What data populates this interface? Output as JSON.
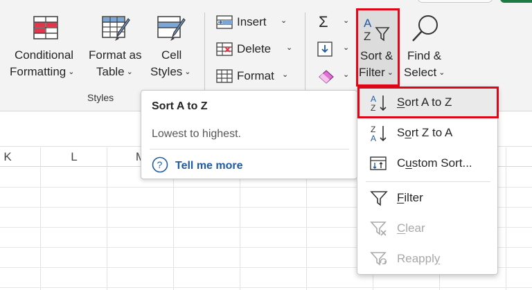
{
  "ribbon": {
    "styles_group": {
      "conditional_formatting": {
        "line1": "Conditional",
        "line2": "Formatting"
      },
      "format_as_table": {
        "line1": "Format as",
        "line2": "Table"
      },
      "cell_styles": {
        "line1": "Cell",
        "line2": "Styles"
      },
      "group_label": "Styles"
    },
    "cells_group": {
      "insert": "Insert",
      "delete": "Delete",
      "format": "Format"
    },
    "editing_group": {
      "sort_filter": {
        "line1": "Sort &",
        "line2": "Filter"
      },
      "find_select": {
        "line1": "Find &",
        "line2": "Select"
      }
    }
  },
  "sheet": {
    "columns": [
      "K",
      "L",
      "M"
    ]
  },
  "tooltip": {
    "title": "Sort A to Z",
    "description": "Lowest to highest.",
    "tell_me_more": "Tell me more"
  },
  "menu": {
    "items": [
      {
        "label": "Sort A to Z",
        "underline": "S",
        "rest": "ort A to Z",
        "enabled": true,
        "icon": "sort-a-z-icon"
      },
      {
        "label": "Sort Z to A",
        "prefix": "S",
        "underline": "o",
        "rest": "rt Z to A",
        "enabled": true,
        "icon": "sort-z-a-icon"
      },
      {
        "label": "Custom Sort...",
        "underline": "U",
        "prefix": "C",
        "rest": "stom Sort...",
        "enabled": true,
        "icon": "custom-sort-icon"
      },
      {
        "label": "Filter",
        "underline": "F",
        "rest": "ilter",
        "enabled": true,
        "icon": "funnel-icon"
      },
      {
        "label": "Clear",
        "underline": "C",
        "rest": "lear",
        "enabled": false,
        "icon": "clear-filter-icon"
      },
      {
        "label": "Reapply",
        "prefix": "Reappl",
        "underline": "y",
        "enabled": false,
        "icon": "reapply-filter-icon"
      }
    ]
  },
  "colors": {
    "highlight_border": "#e0061a",
    "link": "#1f5aa6",
    "disabled_text": "#a8a8a8"
  }
}
